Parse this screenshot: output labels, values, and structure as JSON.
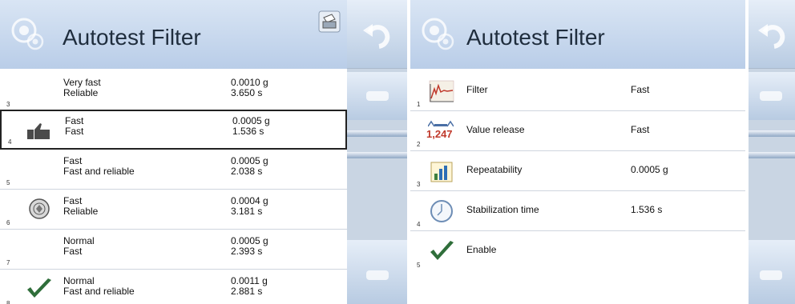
{
  "left": {
    "title": "Autotest Filter",
    "rows": [
      {
        "num": "3",
        "line1": "Very fast",
        "line2": "Reliable",
        "v1": "0.0010 g",
        "v2": "3.650 s",
        "icon": "none"
      },
      {
        "num": "4",
        "line1": "Fast",
        "line2": "Fast",
        "v1": "0.0005 g",
        "v2": "1.536 s",
        "icon": "thumbs-up-icon",
        "selected": true
      },
      {
        "num": "5",
        "line1": "Fast",
        "line2": "Fast and reliable",
        "v1": "0.0005 g",
        "v2": "2.038 s",
        "icon": "none"
      },
      {
        "num": "6",
        "line1": "Fast",
        "line2": "Reliable",
        "v1": "0.0004 g",
        "v2": "3.181 s",
        "icon": "seal-icon"
      },
      {
        "num": "7",
        "line1": "Normal",
        "line2": "Fast",
        "v1": "0.0005 g",
        "v2": "2.393 s",
        "icon": "none"
      },
      {
        "num": "8",
        "line1": "Normal",
        "line2": "Fast and reliable",
        "v1": "0.0011 g",
        "v2": "2.881 s",
        "icon": "checkmark-icon"
      }
    ]
  },
  "right": {
    "title": "Autotest Filter",
    "rows": [
      {
        "num": "1",
        "label": "Filter",
        "value": "Fast",
        "icon": "filter-chart-icon"
      },
      {
        "num": "2",
        "label": "Value release",
        "value": "Fast",
        "icon": "value-release-icon",
        "icon_text": "1,247"
      },
      {
        "num": "3",
        "label": "Repeatability",
        "value": "0.0005 g",
        "icon": "bar-chart-icon"
      },
      {
        "num": "4",
        "label": "Stabilization time",
        "value": "1.536 s",
        "icon": "clock-icon"
      },
      {
        "num": "5",
        "label": "Enable",
        "value": "",
        "icon": "checkmark-icon"
      }
    ]
  },
  "colors": {
    "header_top": "#d9e5f4",
    "header_bottom": "#b9cde8",
    "sidebar": "#c9d5e3",
    "check_green": "#2f6e3a",
    "icon_red": "#c0392b"
  }
}
